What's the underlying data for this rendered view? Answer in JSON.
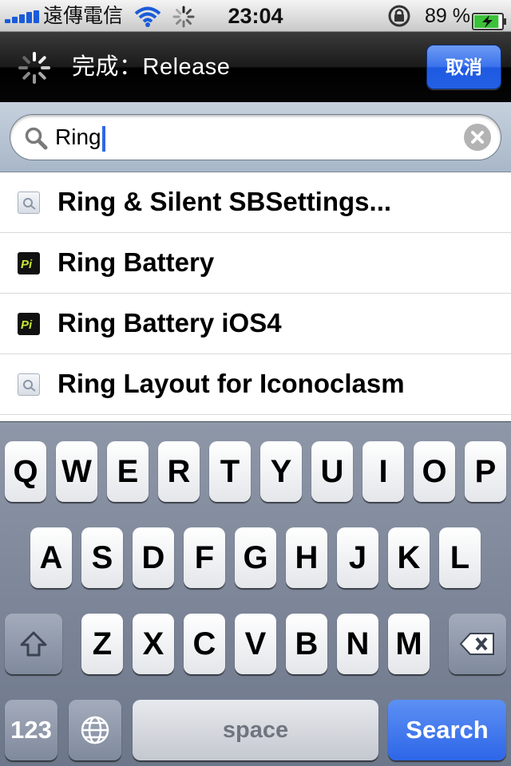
{
  "status_bar": {
    "carrier": "遠傳電信",
    "time": "23:04",
    "battery_percent": "89 %",
    "battery_level": 0.89,
    "icons": [
      "signal-bars-icon",
      "wifi-icon",
      "activity-spinner-icon",
      "rotation-lock-icon",
      "battery-charging-icon"
    ]
  },
  "nav": {
    "title": "完成：Release",
    "cancel_label": "取消",
    "spinner_icon": "loading-spinner-icon"
  },
  "search": {
    "value": "Ring",
    "icons": [
      "magnifier-icon",
      "clear-icon"
    ]
  },
  "results": [
    {
      "label": "Ring & Silent SBSettings...",
      "icon": "generic-package-icon"
    },
    {
      "label": "Ring Battery",
      "icon": "pi-app-icon",
      "icon_text": "Pi"
    },
    {
      "label": "Ring Battery iOS4",
      "icon": "pi-app-icon",
      "icon_text": "Pi"
    },
    {
      "label": "Ring Layout for Iconoclasm",
      "icon": "generic-package-icon"
    }
  ],
  "keyboard": {
    "row1": [
      "Q",
      "W",
      "E",
      "R",
      "T",
      "Y",
      "U",
      "I",
      "O",
      "P"
    ],
    "row2": [
      "A",
      "S",
      "D",
      "F",
      "G",
      "H",
      "J",
      "K",
      "L"
    ],
    "row3": [
      "Z",
      "X",
      "C",
      "V",
      "B",
      "N",
      "M"
    ],
    "numbers_label": "123",
    "space_label": "space",
    "search_label": "Search",
    "special_icons": [
      "shift-icon",
      "backspace-icon",
      "globe-icon"
    ]
  },
  "colors": {
    "accent_blue": "#2d66e8",
    "nav_background": "#000000",
    "keyboard_background": "#7a8497"
  }
}
